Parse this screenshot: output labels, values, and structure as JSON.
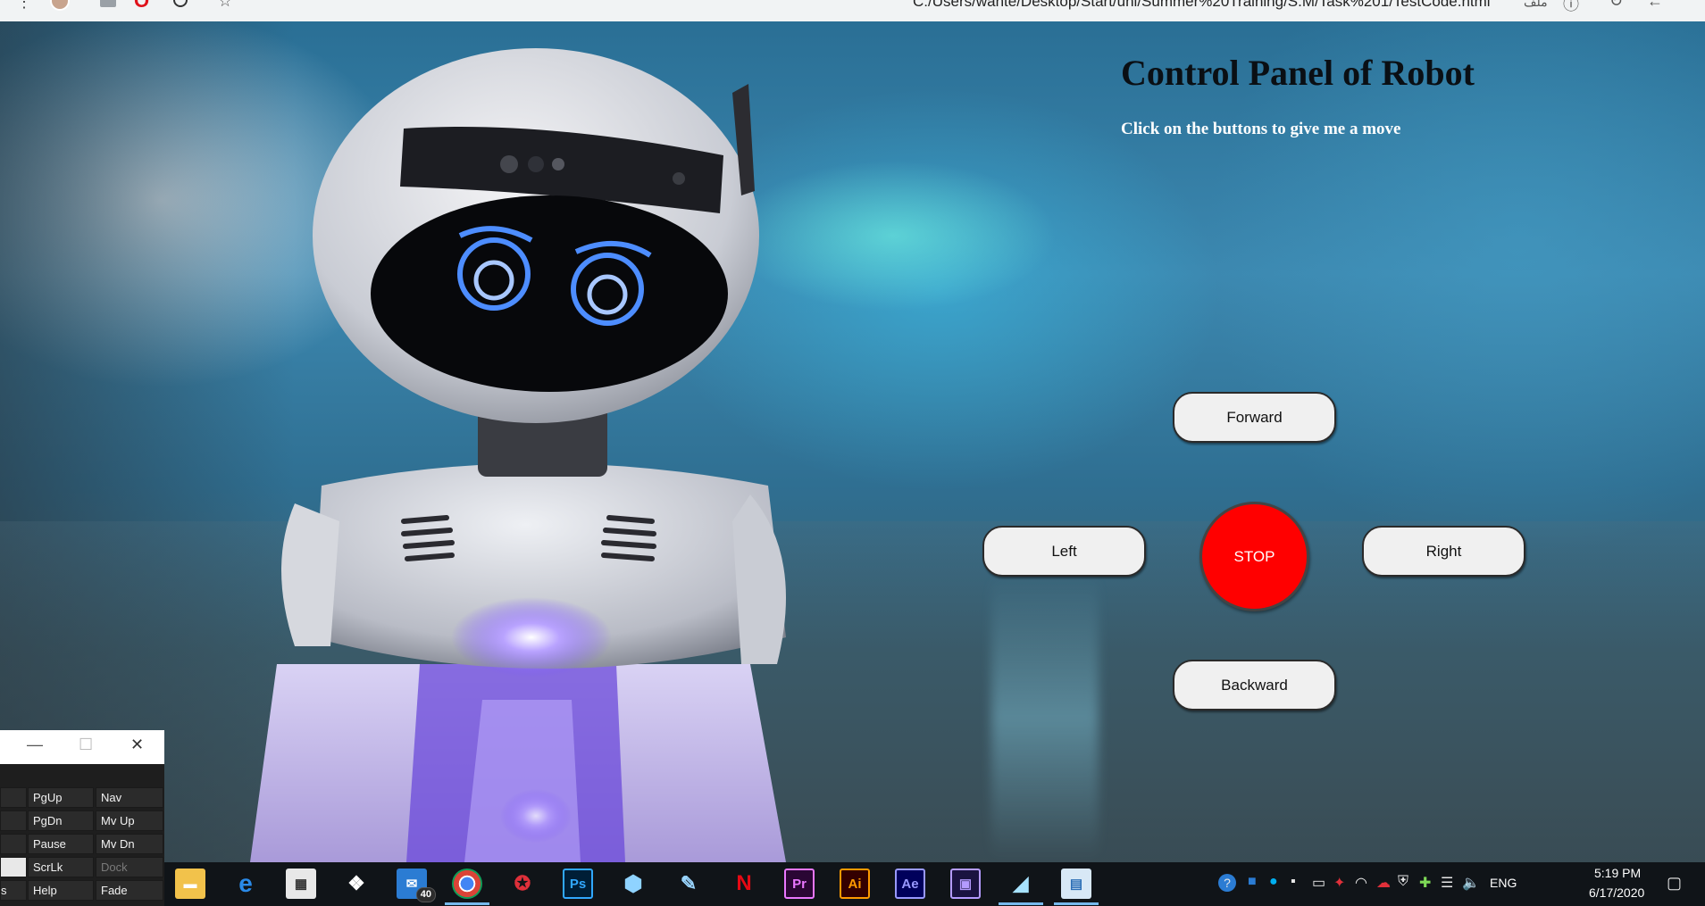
{
  "browser": {
    "address": "C:/Users/wahte/Desktop/Start/uni/Summer%20Training/S.M/Task%201/TestCode.html",
    "address_tag": "ملف",
    "icons": [
      "menu-icon",
      "avatar",
      "extension-icon",
      "opera-icon",
      "extension-icon",
      "star-icon",
      "info-icon",
      "reload-icon",
      "back-icon"
    ]
  },
  "panel": {
    "title": "Control Panel of Robot",
    "subtitle": "Click on the buttons to give me a move"
  },
  "controls": {
    "forward": "Forward",
    "left": "Left",
    "stop": "STOP",
    "right": "Right",
    "backward": "Backward",
    "stop_color": "#ff0000"
  },
  "keyboard": {
    "window_controls": [
      "minimize-icon",
      "maximize-icon",
      "close-icon"
    ],
    "rows": [
      [
        "PgUp",
        "Nav"
      ],
      [
        "PgDn",
        "Mv Up"
      ],
      [
        "Pause",
        "Mv Dn"
      ],
      [
        "ScrLk",
        "Dock"
      ],
      [
        "Help",
        "Fade"
      ]
    ],
    "edge_fragment": "s"
  },
  "taskbar": {
    "apps": [
      {
        "name": "file-explorer-icon",
        "label": ""
      },
      {
        "name": "edge-icon",
        "label": "e"
      },
      {
        "name": "store-icon",
        "label": ""
      },
      {
        "name": "dropbox-icon",
        "label": ""
      },
      {
        "name": "mail-icon",
        "label": "",
        "badge": "40"
      },
      {
        "name": "chrome-icon",
        "label": ""
      },
      {
        "name": "shield-app-icon",
        "label": ""
      },
      {
        "name": "photoshop-icon",
        "label": "Ps"
      },
      {
        "name": "cube-app-icon",
        "label": ""
      },
      {
        "name": "paint-icon",
        "label": ""
      },
      {
        "name": "netflix-icon",
        "label": "N"
      },
      {
        "name": "premiere-icon",
        "label": "Pr"
      },
      {
        "name": "illustrator-icon",
        "label": "Ai"
      },
      {
        "name": "after-effects-icon",
        "label": "Ae"
      },
      {
        "name": "media-encoder-icon",
        "label": ""
      },
      {
        "name": "notes-app-icon",
        "label": ""
      },
      {
        "name": "remote-desktop-icon",
        "label": ""
      }
    ],
    "tray": {
      "language": "ENG",
      "time": "5:19 PM",
      "date": "6/17/2020"
    }
  }
}
